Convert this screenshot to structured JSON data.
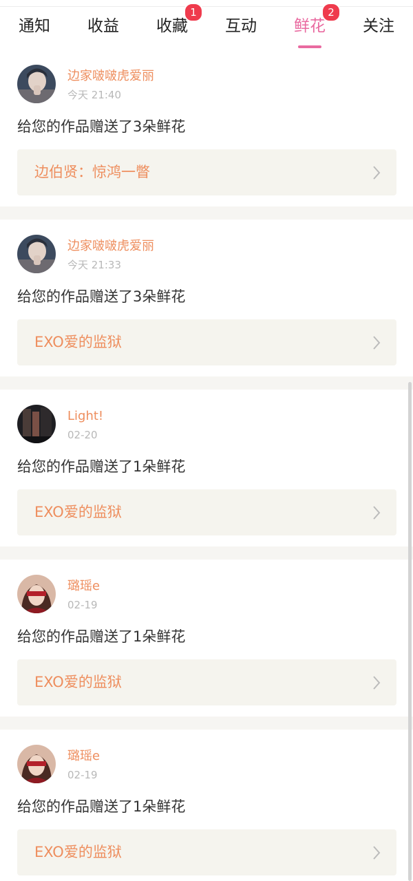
{
  "tabs": [
    {
      "label": "通知",
      "badge": "",
      "active": false
    },
    {
      "label": "收益",
      "badge": "",
      "active": false
    },
    {
      "label": "收藏",
      "badge": "1",
      "active": false
    },
    {
      "label": "互动",
      "badge": "",
      "active": false
    },
    {
      "label": "鲜花",
      "badge": "2",
      "active": true
    },
    {
      "label": "关注",
      "badge": "",
      "active": false
    }
  ],
  "notifications": [
    {
      "user": "边家啵啵虎爱丽",
      "time": "今天 21:40",
      "message": "给您的作品赠送了3朵鲜花",
      "work": "边伯贤：惊鸿一瞥",
      "avatar": "avatar-boy"
    },
    {
      "user": "边家啵啵虎爱丽",
      "time": "今天 21:33",
      "message": "给您的作品赠送了3朵鲜花",
      "work": "EXO爱的监狱",
      "avatar": "avatar-boy"
    },
    {
      "user": "Light!",
      "time": "02-20",
      "message": "给您的作品赠送了1朵鲜花",
      "work": "EXO爱的监狱",
      "avatar": "avatar-dark"
    },
    {
      "user": "璐瑶e",
      "time": "02-19",
      "message": "给您的作品赠送了1朵鲜花",
      "work": "EXO爱的监狱",
      "avatar": "avatar-red"
    },
    {
      "user": "璐瑶e",
      "time": "02-19",
      "message": "给您的作品赠送了1朵鲜花",
      "work": "EXO爱的监狱",
      "avatar": "avatar-red"
    }
  ],
  "colors": {
    "accent": "#e96aa0",
    "username": "#ee8e5e",
    "badge": "#ef3b4d",
    "card_bg": "#f5f4ee"
  }
}
